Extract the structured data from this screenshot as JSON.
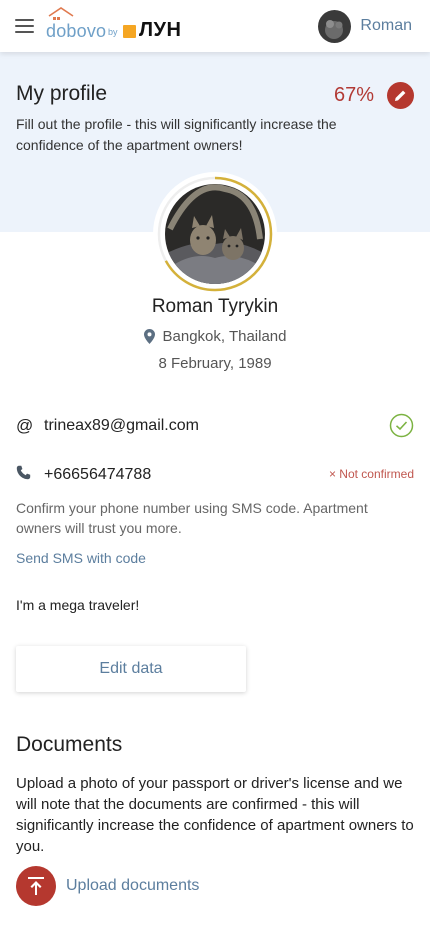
{
  "header": {
    "logo_main": "dobovo",
    "logo_by": "by",
    "logo_partner": "ЛУН",
    "user_name": "Roman"
  },
  "profile": {
    "title": "My profile",
    "completion": "67%",
    "completion_value": 0.67,
    "subtitle": "Fill out the profile - this will significantly increase the confidence of the apartment owners!",
    "full_name": "Roman Tyrykin",
    "location": "Bangkok, Thailand",
    "birth_date": "8 February, 1989"
  },
  "contacts": {
    "email_symbol": "@",
    "email": "trineax89@gmail.com",
    "phone": "+66656474788",
    "phone_status": "× Not confirmed",
    "phone_help": "Confirm your phone number using SMS code. Apartment owners will trust you more.",
    "sms_link": "Send SMS with code"
  },
  "about": "I'm a mega traveler!",
  "edit_button": "Edit data",
  "documents": {
    "title": "Documents",
    "text": "Upload a photo of your passport or driver's license and we will note that the documents are confirmed - this will significantly increase the confidence of apartment owners to you.",
    "upload_label": "Upload documents"
  },
  "icons": {
    "menu": "hamburger-menu-icon",
    "edit": "pencil-icon",
    "location": "map-pin-icon",
    "email_verified": "check-circle-icon",
    "phone": "phone-icon",
    "upload": "upload-arrow-icon"
  },
  "colors": {
    "accent_red": "#b5382f",
    "link_blue": "#5c7e9e",
    "banner_bg": "#edf3fb",
    "verified_green": "#7cb342",
    "progress_ring": "#d4b13a"
  }
}
